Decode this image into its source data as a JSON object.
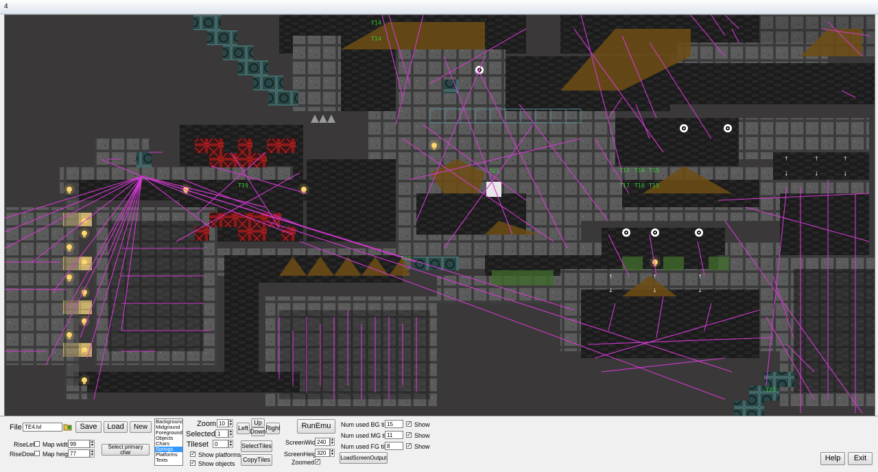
{
  "window": {
    "title": "4"
  },
  "editor": {
    "tile_labels": [
      "T14",
      "T14",
      "T21",
      "T17",
      "T16",
      "T15",
      "T17",
      "T16",
      "T15",
      "T19",
      "T20",
      "T23"
    ]
  },
  "panel": {
    "file_label": "File",
    "file_value": "TE4.lvl",
    "save_label": "Save",
    "load_label": "Load",
    "new_label": "New",
    "rise_left_label": "RiseLeft",
    "rise_down_label": "RiseDown",
    "map_width_label": "Map width",
    "map_width_value": "99",
    "map_height_label": "Map height",
    "map_height_value": "77",
    "select_primary_label": "Select primary char",
    "layers": [
      "Background",
      "Midground",
      "Foreground",
      "Objects",
      "Chars",
      "Springs",
      "Platforms",
      "Texts"
    ],
    "selected_layer_index": 5,
    "zoom_label": "Zoom",
    "zoom_value": "10",
    "selected_label": "Selected",
    "selected_value": "1",
    "tileset_label": "Tileset",
    "tileset_value": "0",
    "show_platforms_label": "Show platforms",
    "show_objects_label": "Show objects",
    "left_label": "Left",
    "up_label": "Up",
    "down_label": "Down",
    "right_label": "Right",
    "select_tiles_label": "SelectTiles",
    "copy_tiles_label": "CopyTiles",
    "run_emu_label": "RunEmu",
    "screen_width_label": "ScreenWidth",
    "screen_width_value": "240",
    "screen_height_label": "ScreenHeight",
    "screen_height_value": "320",
    "zoomed_label": "Zoomed",
    "bg_tiles_label": "Num used BG tiles",
    "bg_tiles_value": "15",
    "mg_tiles_label": "Num used MG tiles",
    "mg_tiles_value": "11",
    "fg_tiles_label": "Num used FG tiles",
    "fg_tiles_value": "8",
    "show_label": "Show",
    "load_screen_output_label": "LoadScreenOutput",
    "help_label": "Help",
    "exit_label": "Exit"
  },
  "colors": {
    "link_lines": "#d43ad4",
    "tile_label": "#2fd12f",
    "canvas_bg": "#3a3838"
  }
}
